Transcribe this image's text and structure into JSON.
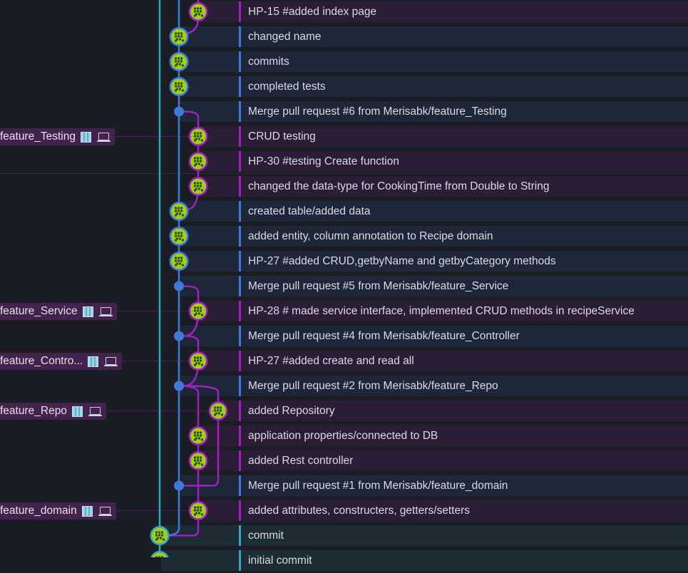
{
  "colors": {
    "main_line": "#35a8c8",
    "develop_line": "#3f7ad8",
    "feature_line": "#a21fbf",
    "avatar_face": "#9fcf1a",
    "avatar_dark": "#2f4a10"
  },
  "commits": [
    {
      "message": "HP-15 #added index page",
      "lane": 2
    },
    {
      "message": "changed name",
      "lane": 1
    },
    {
      "message": "commits",
      "lane": 1
    },
    {
      "message": "completed tests",
      "lane": 1
    },
    {
      "message": "Merge pull request #6 from Merisabk/feature_Testing",
      "lane": 1,
      "merge": true
    },
    {
      "message": "CRUD testing",
      "lane": 2,
      "branch": "feature_Testing"
    },
    {
      "message": "HP-30 #testing Create function",
      "lane": 2
    },
    {
      "message": "changed the data-type for CookingTime from Double to String",
      "lane": 2
    },
    {
      "message": "created table/added data",
      "lane": 1
    },
    {
      "message": "added entity, column annotation to Recipe domain",
      "lane": 1
    },
    {
      "message": "HP-27 #added CRUD,getbyName and getbyCategory methods",
      "lane": 1
    },
    {
      "message": "Merge pull request #5 from Merisabk/feature_Service",
      "lane": 1,
      "merge": true
    },
    {
      "message": "HP-28 # made service interface, implemented CRUD methods in recipeService",
      "lane": 2,
      "branch": "feature_Service"
    },
    {
      "message": "Merge pull request #4 from Merisabk/feature_Controller",
      "lane": 1,
      "merge": true
    },
    {
      "message": "HP-27 #added create and read all",
      "lane": 2,
      "branch": "feature_Contro..."
    },
    {
      "message": "Merge pull request #2 from Merisabk/feature_Repo",
      "lane": 1,
      "merge": true
    },
    {
      "message": "added Repository",
      "lane": 3,
      "branch": "feature_Repo"
    },
    {
      "message": "application properties/connected to DB",
      "lane": 2
    },
    {
      "message": "added Rest controller",
      "lane": 2
    },
    {
      "message": "Merge pull request #1 from Merisabk/feature_domain",
      "lane": 1,
      "merge": true
    },
    {
      "message": "added attributes, constructers, getters/setters",
      "lane": 2,
      "branch": "feature_domain"
    },
    {
      "message": "commit",
      "lane": 0
    },
    {
      "message": "initial commit",
      "lane": 0
    }
  ]
}
